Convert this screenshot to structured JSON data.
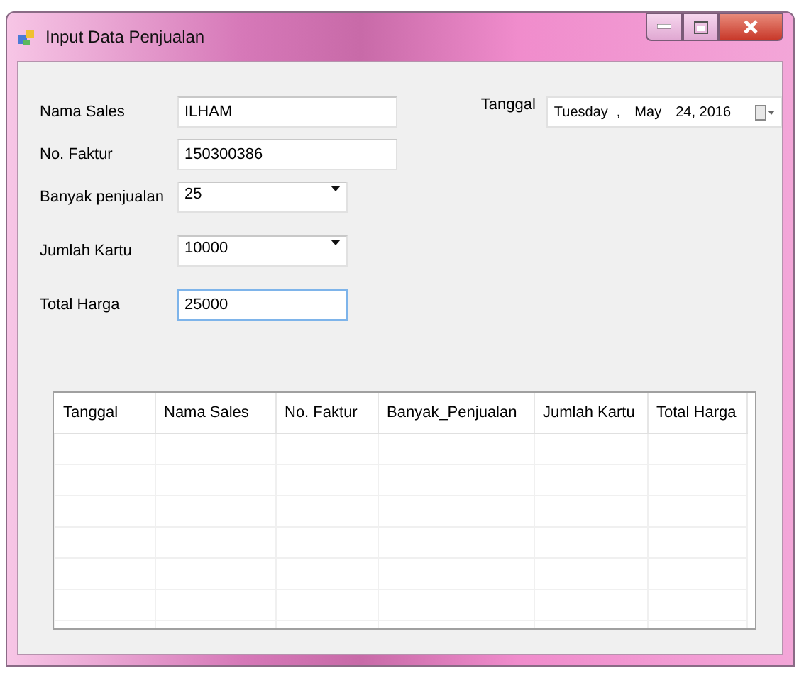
{
  "window": {
    "title": "Input Data Penjualan"
  },
  "fields": [
    {
      "label": "Nama Sales",
      "kind": "text",
      "value": "ILHAM",
      "focused": false
    },
    {
      "label": "No. Faktur",
      "kind": "text",
      "value": "150300386",
      "focused": false
    },
    {
      "label": "Banyak penjualan",
      "kind": "combo",
      "value": "25",
      "focused": false
    },
    {
      "label": "Jumlah Kartu",
      "kind": "combo",
      "value": "10000",
      "focused": false
    },
    {
      "label": "Total Harga",
      "kind": "short",
      "value": "25000",
      "focused": true
    }
  ],
  "date": {
    "label": "Tanggal",
    "weekday": "Tuesday",
    "separator": ",",
    "month": "May",
    "day_year": "24, 2016"
  },
  "table": {
    "columns": [
      "Tanggal",
      "Nama Sales",
      "No. Faktur",
      "Banyak_Penjualan",
      "Jumlah Kartu",
      "Total Harga"
    ]
  }
}
